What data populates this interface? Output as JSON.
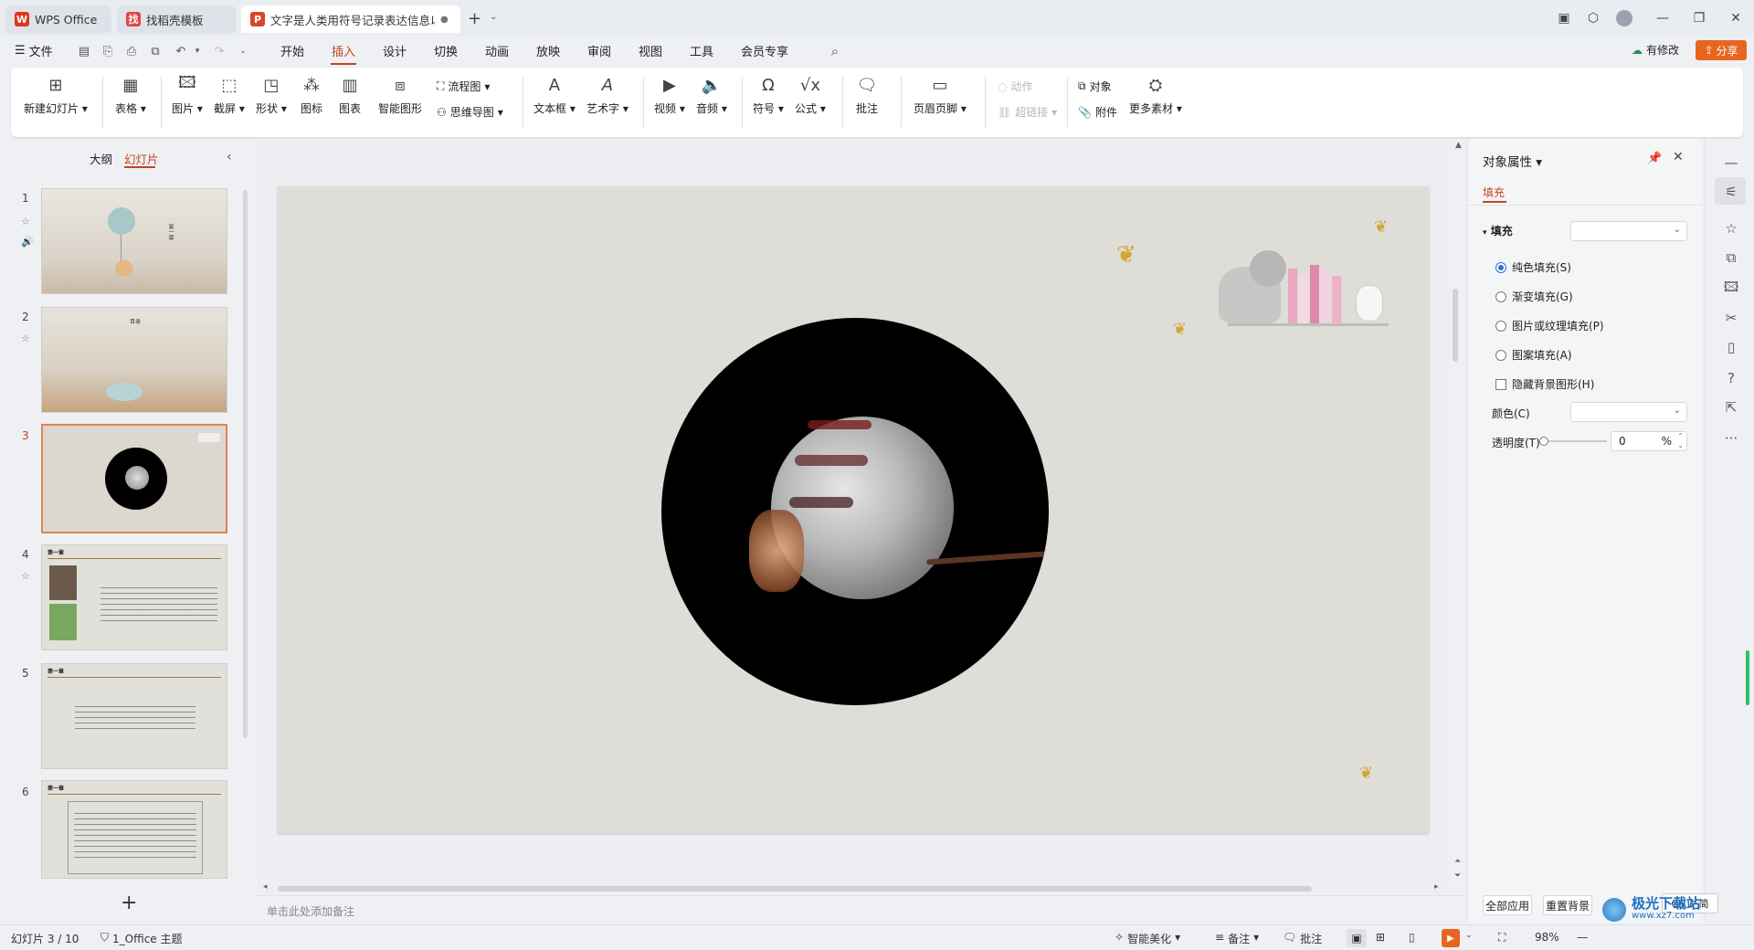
{
  "tabs": {
    "app_tab": "WPS Office",
    "template_tab": "找稻壳模板",
    "doc_tab": "文字是人类用符号记录表达信息以",
    "new_tab": "+"
  },
  "menu": {
    "file": "文件",
    "items": [
      "开始",
      "插入",
      "设计",
      "切换",
      "动画",
      "放映",
      "审阅",
      "视图",
      "工具",
      "会员专享"
    ],
    "active": "插入",
    "modified": "有修改",
    "share": "分享"
  },
  "ribbon": {
    "new_slide": "新建幻灯片",
    "table": "表格",
    "picture": "图片",
    "screenshot": "截屏",
    "shape": "形状",
    "icon": "图标",
    "chart": "图表",
    "smart_art": "智能图形",
    "flowchart": "流程图",
    "mindmap": "思维导图",
    "textbox": "文本框",
    "art_text": "艺术字",
    "video": "视频",
    "audio": "音频",
    "symbol": "符号",
    "formula": "公式",
    "comment": "批注",
    "header_footer": "页眉页脚",
    "action": "动作",
    "hyperlink": "超链接",
    "object": "对象",
    "attachment": "附件",
    "more_material": "更多素材"
  },
  "left_panel": {
    "outline_tab": "大纲",
    "slides_tab": "幻灯片",
    "slides": [
      {
        "num": "1",
        "title": "第一章"
      },
      {
        "num": "2",
        "title": "目录"
      },
      {
        "num": "3",
        "title": ""
      },
      {
        "num": "4",
        "title": "第一章"
      },
      {
        "num": "5",
        "title": "第一章"
      },
      {
        "num": "6",
        "title": "第一章"
      }
    ],
    "add": "+"
  },
  "notes_placeholder": "单击此处添加备注",
  "right_panel": {
    "title": "对象属性",
    "tab": "填充",
    "section": "填充",
    "options": [
      "纯色填充(S)",
      "渐变填充(G)",
      "图片或纹理填充(P)",
      "图案填充(A)"
    ],
    "selected_option": "纯色填充(S)",
    "hide_bg": "隐藏背景图形(H)",
    "color_label": "颜色(C)",
    "transparency_label": "透明度(T)",
    "transparency_value": "0",
    "percent": "%",
    "apply_all": "全部应用",
    "reset_bg": "重置背景"
  },
  "ime": "CH ♪ 简",
  "watermark": {
    "text": "极光下载站",
    "url": "www.xz7.com"
  },
  "status": {
    "slide_info": "幻灯片 3 / 10",
    "theme": "1_Office 主题",
    "beautify": "智能美化",
    "notes": "备注",
    "comment": "批注",
    "zoom": "98%"
  },
  "colors": {
    "accent": "#c2461f",
    "share_bg": "#e8651f",
    "slide_bg": "#deddd8",
    "selected_thumb": "#e0834f"
  }
}
